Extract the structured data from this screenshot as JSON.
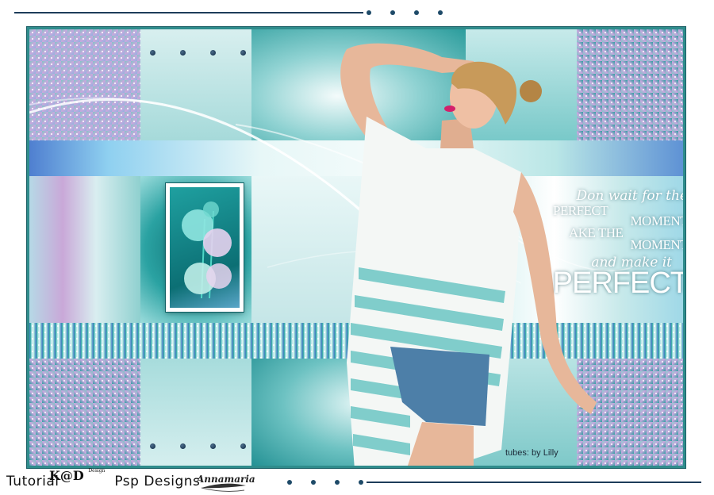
{
  "artwork": {
    "quote": {
      "line1": "Don  wait for the",
      "line2": "PERFECT",
      "line3": "MOMENT",
      "line4": "AKE THE",
      "line5": "MOMENT",
      "line6": "and make it",
      "line7": "PERFECT"
    },
    "credit": "tubes: by Lilly",
    "colors": {
      "teal": "#2a9a9a",
      "dark_teal": "#0f6f73",
      "lavender": "#c9a6d8",
      "blue": "#5c8fd0",
      "navy": "#1e3d5a"
    }
  },
  "footer": {
    "tutorial_label": "Tutorial",
    "brand_logo": "K@D",
    "brand_logo_small": "Design",
    "psp_label": "Psp Designs",
    "signature": "Annamaria"
  }
}
